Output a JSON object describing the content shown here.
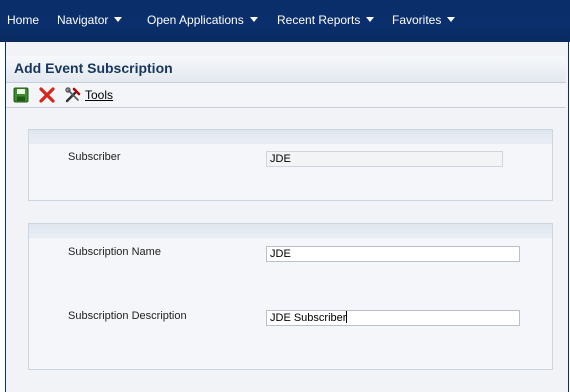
{
  "nav": {
    "items": [
      {
        "label": "Home",
        "caret": false
      },
      {
        "label": "Navigator",
        "caret": true
      },
      {
        "label": "Open Applications",
        "caret": true
      },
      {
        "label": "Recent Reports",
        "caret": true
      },
      {
        "label": "Favorites",
        "caret": true
      }
    ]
  },
  "page": {
    "title": "Add Event Subscription"
  },
  "toolbar": {
    "save_icon": "save-icon",
    "cancel_icon": "cancel-x-icon",
    "tools_icon": "tools-icon",
    "tools_label": "Tools"
  },
  "subscriber_section": {
    "subscriber_label": "Subscriber",
    "subscriber_value": "JDE"
  },
  "subscription_section": {
    "name_label": "Subscription Name",
    "name_value": "JDE",
    "description_label": "Subscription Description",
    "description_value": "JDE Subscriber"
  },
  "colors": {
    "nav_bg": "#0b2f6c",
    "title_text": "#17375e",
    "cancel_red": "#d9261c"
  }
}
